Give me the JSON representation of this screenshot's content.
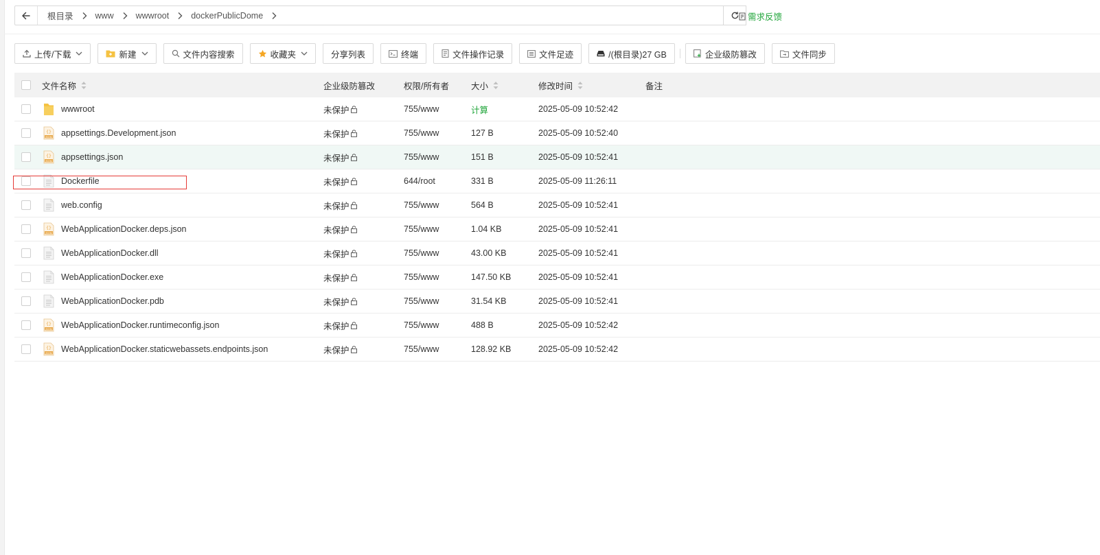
{
  "breadcrumb": {
    "items": [
      "根目录",
      "www",
      "wwwroot",
      "dockerPublicDome"
    ]
  },
  "feedback_label": "需求反馈",
  "toolbar": {
    "upload_download": "上传/下载",
    "new": "新建",
    "content_search": "文件内容搜索",
    "favorites": "收藏夹",
    "share_list": "分享列表",
    "terminal": "终端",
    "op_log": "文件操作记录",
    "footprint": "文件足迹",
    "disk": "/(根目录)27 GB",
    "tamper_proof": "企业级防篡改",
    "file_sync": "文件同步"
  },
  "table": {
    "headers": {
      "name": "文件名称",
      "protection": "企业级防篡改",
      "permission": "权限/所有者",
      "size": "大小",
      "mtime": "修改时间",
      "note": "备注"
    },
    "rows": [
      {
        "name": "wwwroot",
        "type": "folder",
        "protection": "未保护",
        "permission": "755/www",
        "size": "计算",
        "mtime": "2025-05-09 10:52:42"
      },
      {
        "name": "appsettings.Development.json",
        "type": "json",
        "protection": "未保护",
        "permission": "755/www",
        "size": "127 B",
        "mtime": "2025-05-09 10:52:40"
      },
      {
        "name": "appsettings.json",
        "type": "json",
        "protection": "未保护",
        "permission": "755/www",
        "size": "151 B",
        "mtime": "2025-05-09 10:52:41"
      },
      {
        "name": "Dockerfile",
        "type": "file",
        "protection": "未保护",
        "permission": "644/root",
        "size": "331 B",
        "mtime": "2025-05-09 11:26:11"
      },
      {
        "name": "web.config",
        "type": "file",
        "protection": "未保护",
        "permission": "755/www",
        "size": "564 B",
        "mtime": "2025-05-09 10:52:41"
      },
      {
        "name": "WebApplicationDocker.deps.json",
        "type": "json",
        "protection": "未保护",
        "permission": "755/www",
        "size": "1.04 KB",
        "mtime": "2025-05-09 10:52:41"
      },
      {
        "name": "WebApplicationDocker.dll",
        "type": "file",
        "protection": "未保护",
        "permission": "755/www",
        "size": "43.00 KB",
        "mtime": "2025-05-09 10:52:41"
      },
      {
        "name": "WebApplicationDocker.exe",
        "type": "file",
        "protection": "未保护",
        "permission": "755/www",
        "size": "147.50 KB",
        "mtime": "2025-05-09 10:52:41"
      },
      {
        "name": "WebApplicationDocker.pdb",
        "type": "file",
        "protection": "未保护",
        "permission": "755/www",
        "size": "31.54 KB",
        "mtime": "2025-05-09 10:52:41"
      },
      {
        "name": "WebApplicationDocker.runtimeconfig.json",
        "type": "json",
        "protection": "未保护",
        "permission": "755/www",
        "size": "488 B",
        "mtime": "2025-05-09 10:52:42"
      },
      {
        "name": "WebApplicationDocker.staticwebassets.endpoints.json",
        "type": "json",
        "protection": "未保护",
        "permission": "755/www",
        "size": "128.92 KB",
        "mtime": "2025-05-09 10:52:42"
      }
    ]
  },
  "colors": {
    "accent": "#20a53a",
    "highlight_row": "#f0f8f5",
    "selection_box": "#e53935",
    "folder": "#f5c242",
    "json_icon": "#e8a84a"
  }
}
